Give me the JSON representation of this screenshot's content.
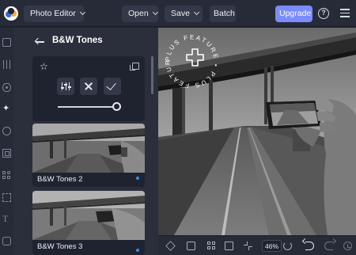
{
  "header": {
    "editor_label": "Photo Editor",
    "open_label": "Open",
    "save_label": "Save",
    "batch_label": "Batch",
    "upgrade_label": "Upgrade",
    "help_glyph": "?"
  },
  "rail": {
    "icons": [
      "image-icon",
      "adjust-icon",
      "eye-icon",
      "effects-icon",
      "paint-icon",
      "frame-icon",
      "elements-icon",
      "texture-icon",
      "text-icon",
      "more-icon"
    ],
    "active": "effects-icon",
    "text_glyph": "T",
    "effects_glyph": "✦"
  },
  "panel": {
    "title": "B&W Tones",
    "active_card": {
      "favorite_glyph": "☆",
      "intensity": 1.0
    },
    "thumbnails": [
      {
        "label": "B&W Tones 2",
        "premium_dot": true
      },
      {
        "label": "B&W Tones 3",
        "premium_dot": true
      }
    ]
  },
  "canvas": {
    "badge_text": "PLUS FEATURE • PLUS FEATURE •"
  },
  "bottom_toolbar": {
    "zoom": "46%"
  },
  "colors": {
    "accent": "#7b8cff",
    "premium_dot": "#2f8fe9",
    "panel_bg": "#2b2f3c",
    "bar_bg": "#272b38"
  }
}
